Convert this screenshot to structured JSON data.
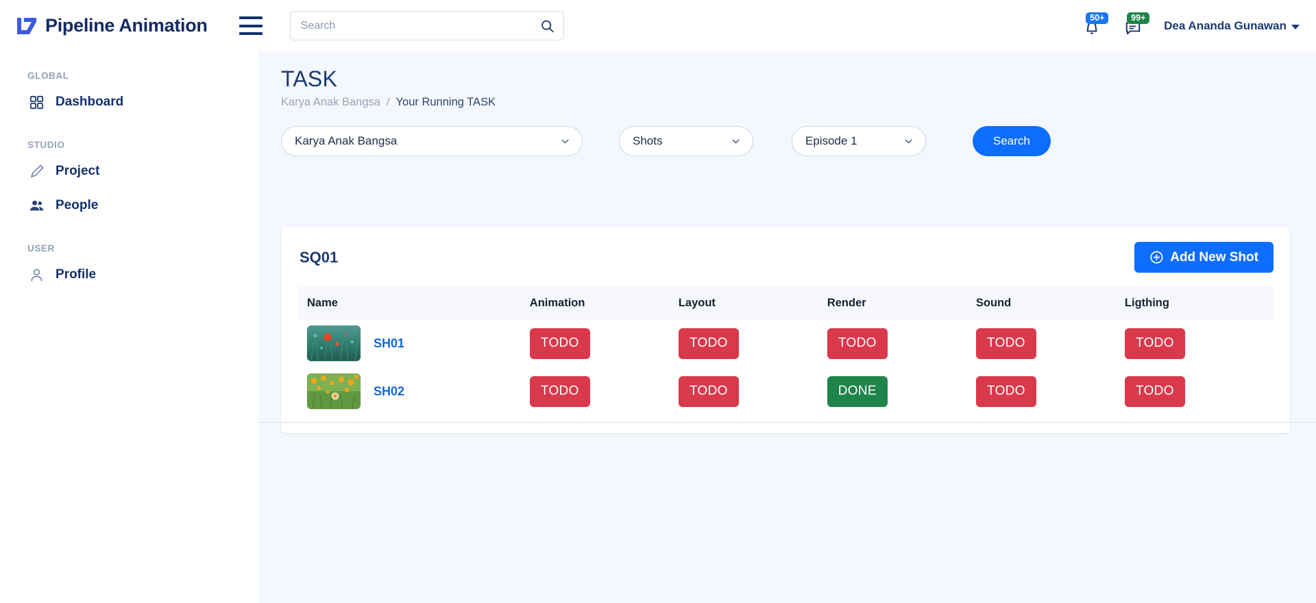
{
  "header": {
    "brand": "Pipeline Animation",
    "brand_logo_icon": "pipeline-logo-icon",
    "menu_icon": "hamburger-menu-icon",
    "search": {
      "placeholder": "Search",
      "value": "",
      "icon": "search-icon"
    },
    "notifications": {
      "icon": "bell-icon",
      "badge": "50+",
      "badge_color": "#1877f2"
    },
    "messages": {
      "icon": "chat-icon",
      "badge": "99+",
      "badge_color": "#1e8449"
    },
    "user": {
      "name": "Dea Ananda Gunawan",
      "caret_icon": "chevron-down-icon"
    }
  },
  "sidebar": {
    "groups": [
      {
        "label": "GLOBAL",
        "items": [
          {
            "label": "Dashboard",
            "icon": "grid-icon"
          }
        ]
      },
      {
        "label": "STUDIO",
        "items": [
          {
            "label": "Project",
            "icon": "pencil-icon"
          },
          {
            "label": "People",
            "icon": "people-icon"
          }
        ]
      },
      {
        "label": "USER",
        "items": [
          {
            "label": "Profile",
            "icon": "user-icon"
          }
        ]
      }
    ]
  },
  "main": {
    "title": "TASK",
    "breadcrumb": {
      "parent": "Karya Anak Bangsa",
      "separator": "/",
      "current": "Your Running TASK"
    },
    "filters": {
      "project": {
        "value": "Karya Anak Bangsa",
        "chevron_icon": "chevron-down-icon"
      },
      "type": {
        "value": "Shots",
        "chevron_icon": "chevron-down-icon"
      },
      "episode": {
        "value": "Episode 1",
        "chevron_icon": "chevron-down-icon"
      },
      "search_button": "Search"
    },
    "card": {
      "sequence": "SQ01",
      "add_button": {
        "label": "Add New Shot",
        "icon": "plus-circle-icon"
      },
      "columns": [
        "Name",
        "Animation",
        "Layout",
        "Render",
        "Sound",
        "Ligthing"
      ],
      "rows": [
        {
          "name": "SH01",
          "thumbnail_icon": "poppy-meadow-thumbnail",
          "statuses": [
            {
              "label": "TODO",
              "state": "todo"
            },
            {
              "label": "TODO",
              "state": "todo"
            },
            {
              "label": "TODO",
              "state": "todo"
            },
            {
              "label": "TODO",
              "state": "todo"
            },
            {
              "label": "TODO",
              "state": "todo"
            }
          ]
        },
        {
          "name": "SH02",
          "thumbnail_icon": "marigold-field-thumbnail",
          "statuses": [
            {
              "label": "TODO",
              "state": "todo"
            },
            {
              "label": "TODO",
              "state": "todo"
            },
            {
              "label": "DONE",
              "state": "done"
            },
            {
              "label": "TODO",
              "state": "todo"
            },
            {
              "label": "TODO",
              "state": "todo"
            }
          ]
        }
      ]
    }
  },
  "colors": {
    "accent_blue": "#0d6efd",
    "navy": "#1b3a72",
    "status_todo": "#d9394b",
    "status_done": "#1e8449",
    "page_bg": "#f4f7fd"
  }
}
